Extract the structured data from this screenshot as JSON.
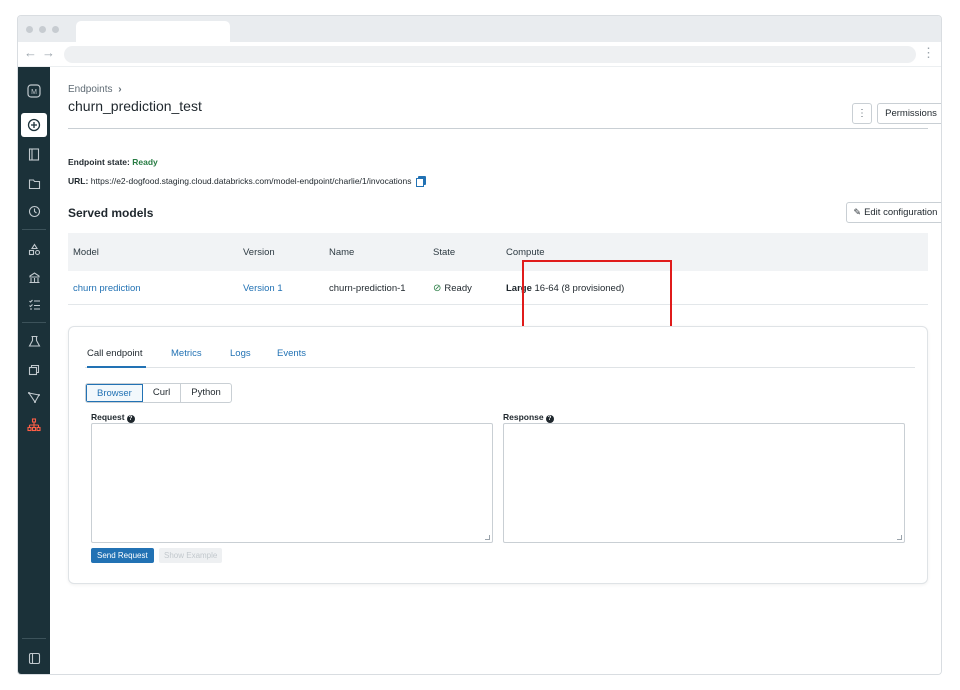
{
  "browser": {
    "back_icon": "←",
    "forward_icon": "→",
    "menu_icon": "⋮"
  },
  "sidebar": {
    "logo": "M",
    "icons": [
      "plus-circle-icon",
      "notebook-icon",
      "folder-icon",
      "clock-icon",
      "shapes-icon",
      "model-registry-icon",
      "checklist-icon",
      "beaker-icon",
      "feature-store-icon",
      "experiments-icon",
      "serving-icon",
      "collapse-icon"
    ]
  },
  "header": {
    "breadcrumb": "Endpoints",
    "breadcrumb_chevron": "›",
    "title": "churn_prediction_test",
    "more_icon": "⋮",
    "permissions_label": "Permissions"
  },
  "endpoint": {
    "state_label": "Endpoint state:",
    "state_value": "Ready",
    "url_label": "URL:",
    "url_value": "https://e2-dogfood.staging.cloud.databricks.com/model-endpoint/charlie/1/invocations"
  },
  "served_models": {
    "title": "Served models",
    "edit_label": "Edit configuration",
    "edit_icon": "✎",
    "columns": [
      "Model",
      "Version",
      "Name",
      "State",
      "Compute"
    ],
    "rows": [
      {
        "model": "churn prediction",
        "version": "Version 1",
        "name": "churn-prediction-1",
        "state_icon": "⊘",
        "state": "Ready",
        "compute_size": "Large",
        "compute_detail": "16-64 (8 provisioned)"
      }
    ]
  },
  "call_panel": {
    "tabs": [
      "Call endpoint",
      "Metrics",
      "Logs",
      "Events"
    ],
    "formats": [
      "Browser",
      "Curl",
      "Python"
    ],
    "request_label": "Request",
    "response_label": "Response",
    "help_icon": "?",
    "send_label": "Send Request",
    "example_label": "Show Example"
  },
  "colors": {
    "accent": "#2272b4",
    "sidebar_bg": "#1b3139",
    "ready_green": "#277c43",
    "highlight_red": "#e01b1b"
  }
}
